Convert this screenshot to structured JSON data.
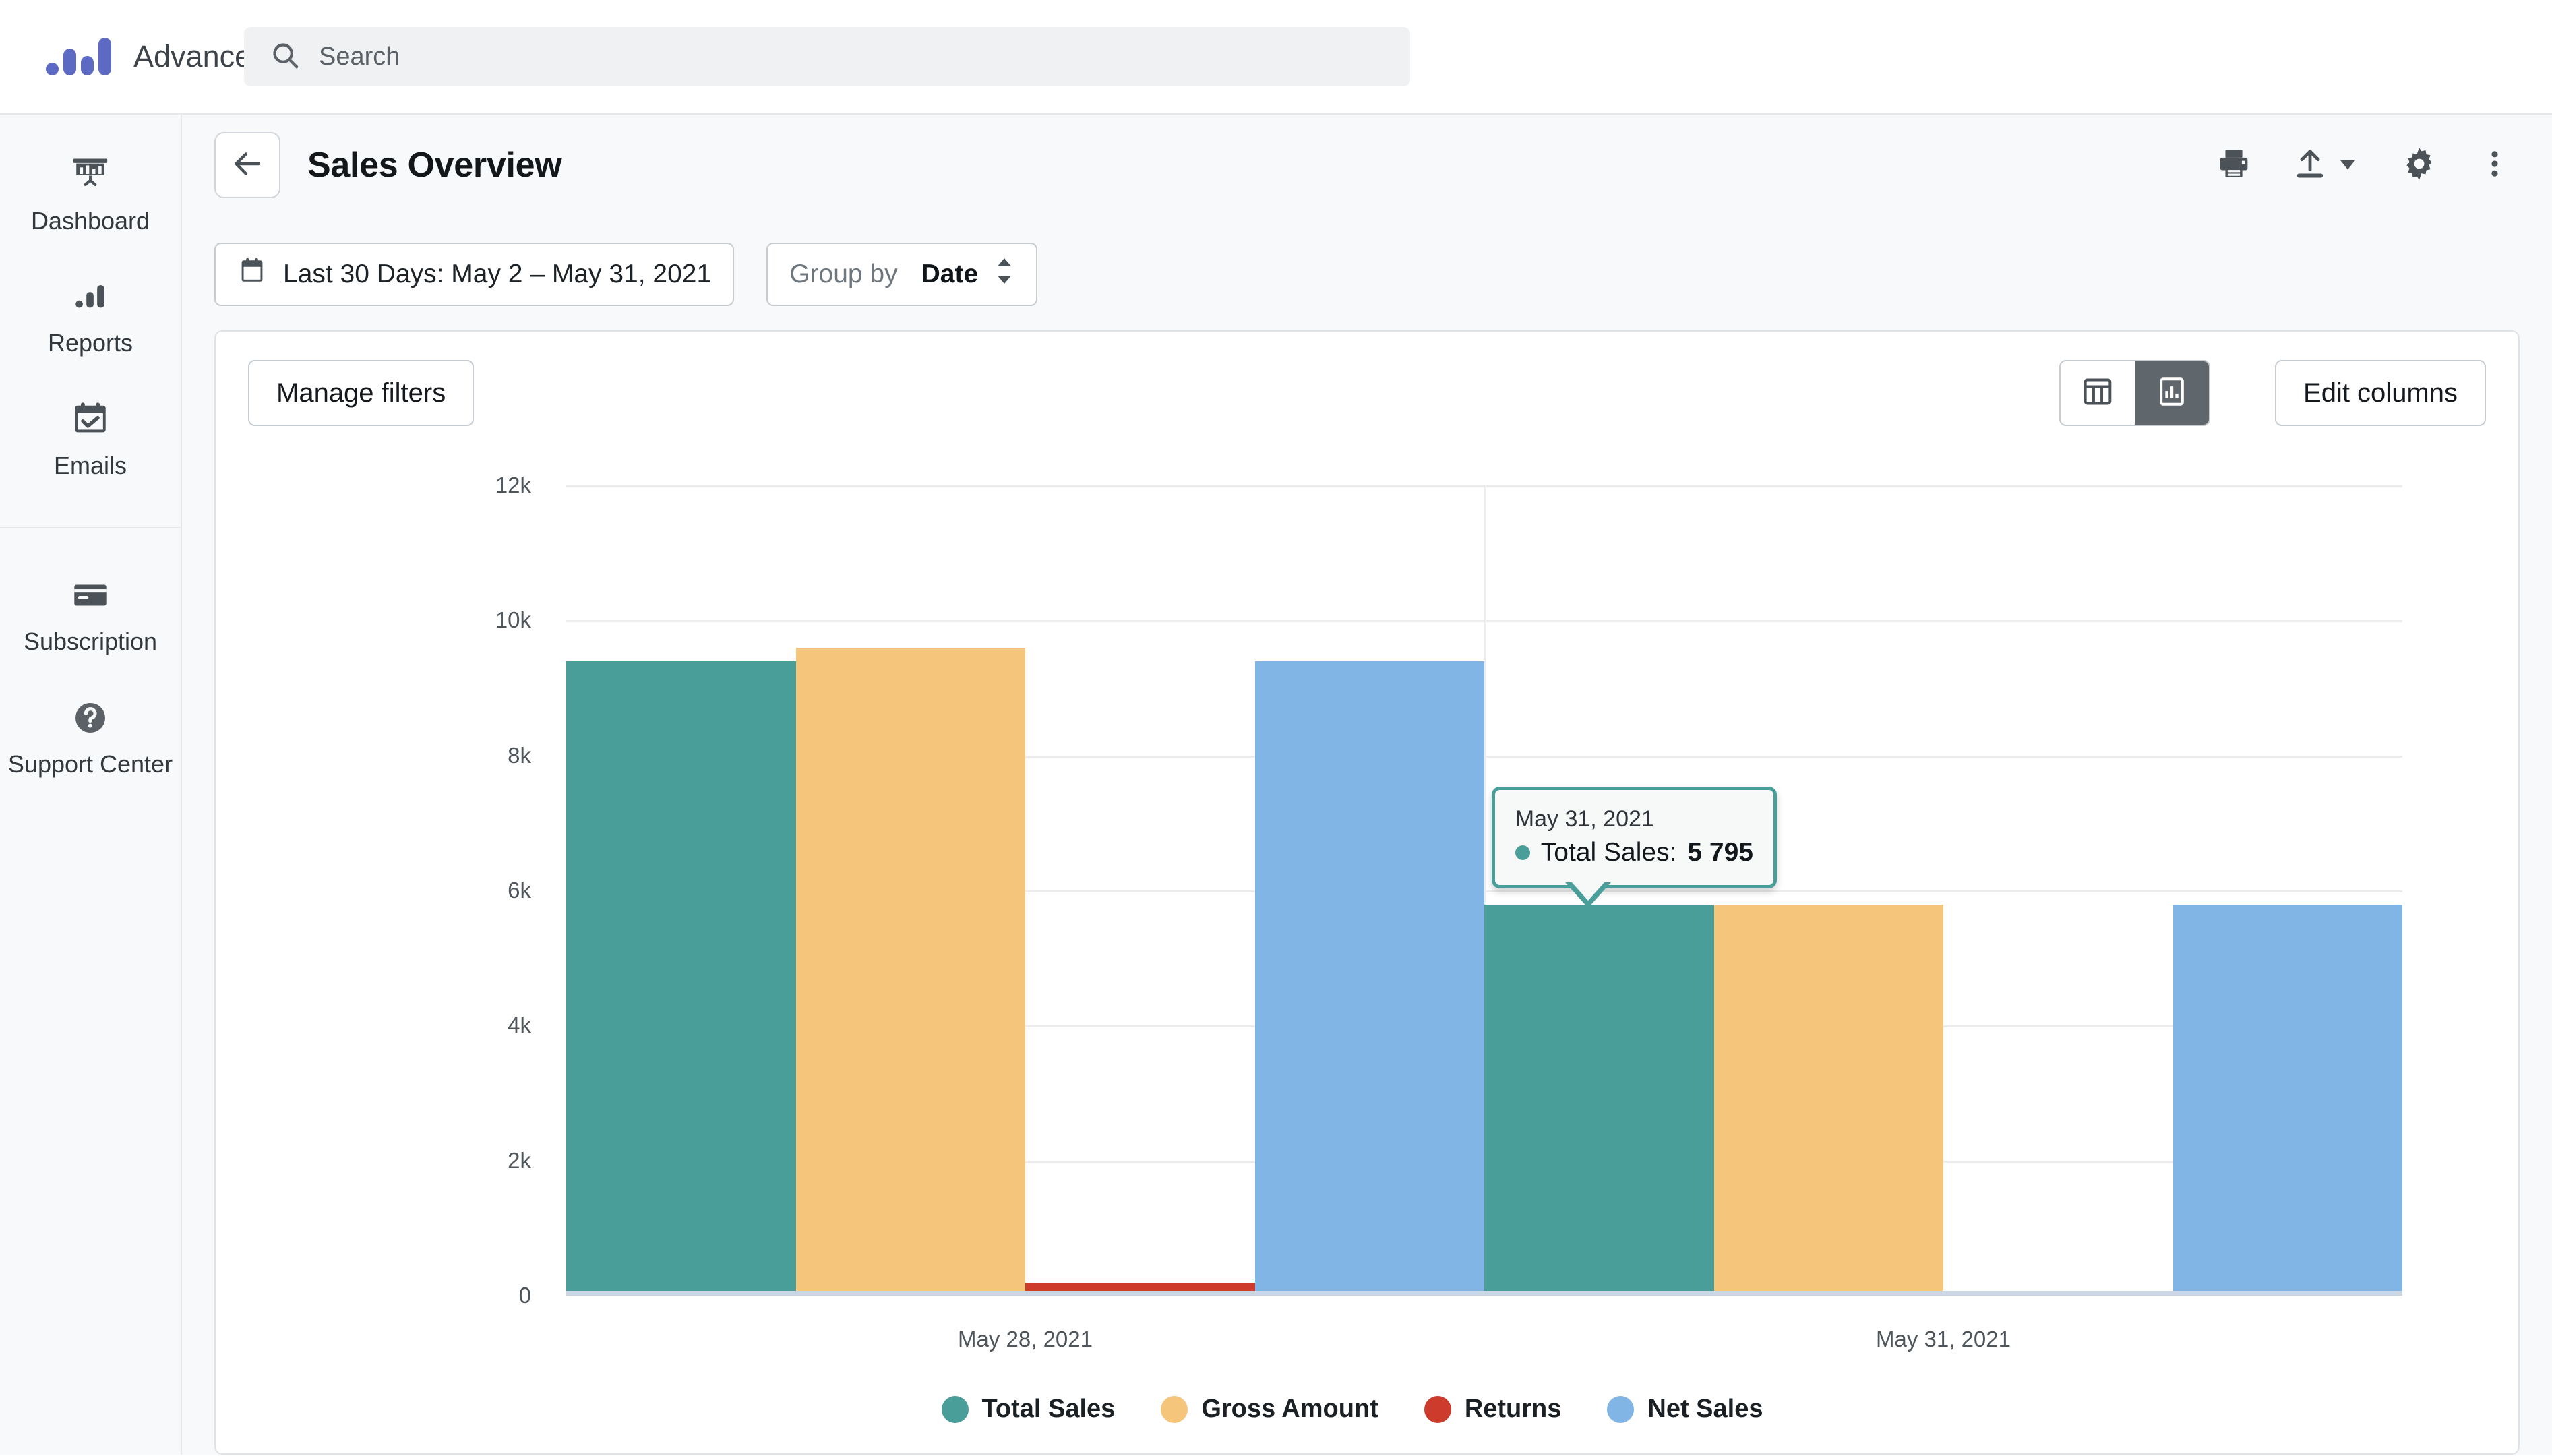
{
  "app": {
    "name": "Advanced Reports",
    "logo_color": "#5c6ac4"
  },
  "search": {
    "placeholder": "Search",
    "value": ""
  },
  "sidebar": {
    "items": [
      {
        "label": "Dashboard",
        "icon": "presentation-chart-icon"
      },
      {
        "label": "Reports",
        "icon": "bar-chart-icon"
      },
      {
        "label": "Emails",
        "icon": "calendar-check-icon"
      },
      {
        "label": "Subscription",
        "icon": "credit-card-icon"
      },
      {
        "label": "Support Center",
        "icon": "help-circle-icon"
      }
    ]
  },
  "page": {
    "title": "Sales Overview",
    "back_icon": "arrow-left-icon",
    "actions": [
      {
        "name": "print",
        "icon": "printer-icon"
      },
      {
        "name": "export",
        "icon": "upload-icon"
      },
      {
        "name": "settings",
        "icon": "gear-icon"
      },
      {
        "name": "more",
        "icon": "kebab-menu-icon"
      }
    ]
  },
  "filters": {
    "date_range": "Last 30 Days: May 2 – May 31, 2021",
    "date_icon": "calendar-icon",
    "group_by_label": "Group by",
    "group_by_value": "Date"
  },
  "toolbar": {
    "manage_filters_label": "Manage filters",
    "edit_columns_label": "Edit columns",
    "view_table_icon": "table-view-icon",
    "view_chart_icon": "chart-view-icon",
    "active_view": "chart"
  },
  "tooltip": {
    "date": "May 31, 2021",
    "series": "Total Sales",
    "value": "5 795",
    "separator": ":",
    "accent": "#4a9e99"
  },
  "chart_data": {
    "type": "bar",
    "title": "",
    "xlabel": "",
    "ylabel": "",
    "categories": [
      "May 28, 2021",
      "May 31, 2021"
    ],
    "ylim": [
      0,
      12000
    ],
    "yticks": [
      0,
      2000,
      4000,
      6000,
      8000,
      10000,
      12000
    ],
    "ytick_labels": [
      "0",
      "2k",
      "4k",
      "6k",
      "8k",
      "10k",
      "12k"
    ],
    "grid": true,
    "legend_position": "bottom",
    "series": [
      {
        "name": "Total Sales",
        "color": "#4a9e99",
        "values": [
          9390,
          5795
        ]
      },
      {
        "name": "Gross Amount",
        "color": "#f5c57c",
        "values": [
          9590,
          5795
        ]
      },
      {
        "name": "Returns",
        "color": "#cc3b2b",
        "values": [
          190,
          0
        ]
      },
      {
        "name": "Net Sales",
        "color": "#81b5e5",
        "values": [
          9390,
          5795
        ]
      }
    ]
  }
}
